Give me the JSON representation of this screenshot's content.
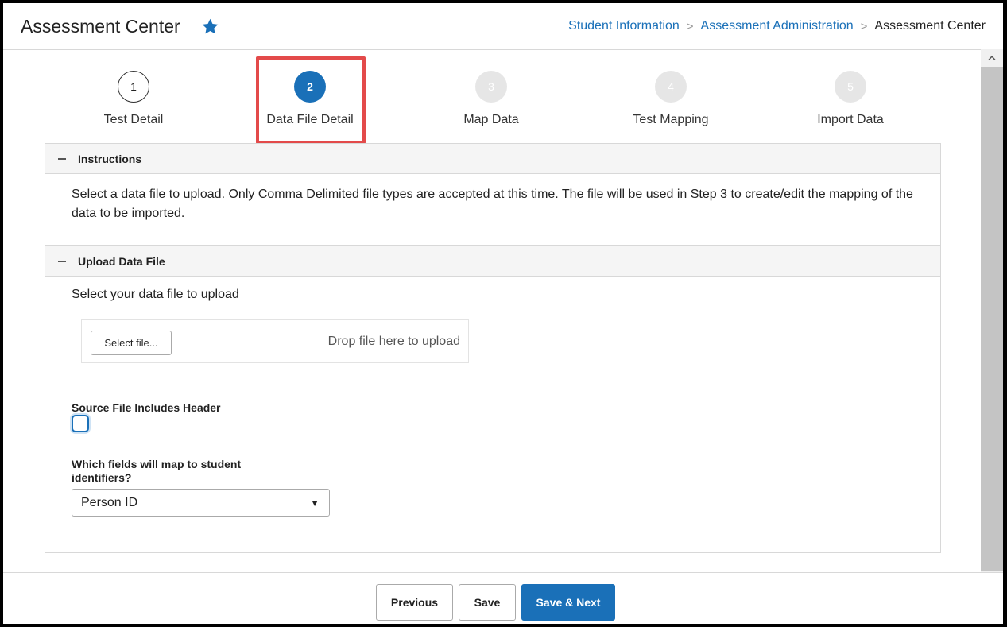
{
  "header": {
    "title": "Assessment Center",
    "breadcrumb": [
      "Student Information",
      "Assessment Administration",
      "Assessment Center"
    ]
  },
  "stepper": {
    "steps": [
      {
        "number": "1",
        "label": "Test Detail",
        "state": "done"
      },
      {
        "number": "2",
        "label": "Data File Detail",
        "state": "active"
      },
      {
        "number": "3",
        "label": "Map Data",
        "state": "todo"
      },
      {
        "number": "4",
        "label": "Test Mapping",
        "state": "todo"
      },
      {
        "number": "5",
        "label": "Import Data",
        "state": "todo"
      }
    ]
  },
  "instructions": {
    "heading": "Instructions",
    "text": "Select a data file to upload. Only Comma Delimited file types are accepted at this time. The file will be used in Step 3 to create/edit the mapping of the data to be imported."
  },
  "upload": {
    "heading": "Upload Data File",
    "prompt": "Select your data file to upload",
    "select_button": "Select file...",
    "drop_text": "Drop file here to upload",
    "header_label": "Source File Includes Header",
    "header_checked": false,
    "identifier_label": "Which fields will map to student identifiers?",
    "identifier_value": "Person ID"
  },
  "footer": {
    "previous": "Previous",
    "save": "Save",
    "save_next": "Save & Next"
  },
  "colors": {
    "accent": "#1a70b8",
    "highlight": "#e34a4a"
  }
}
